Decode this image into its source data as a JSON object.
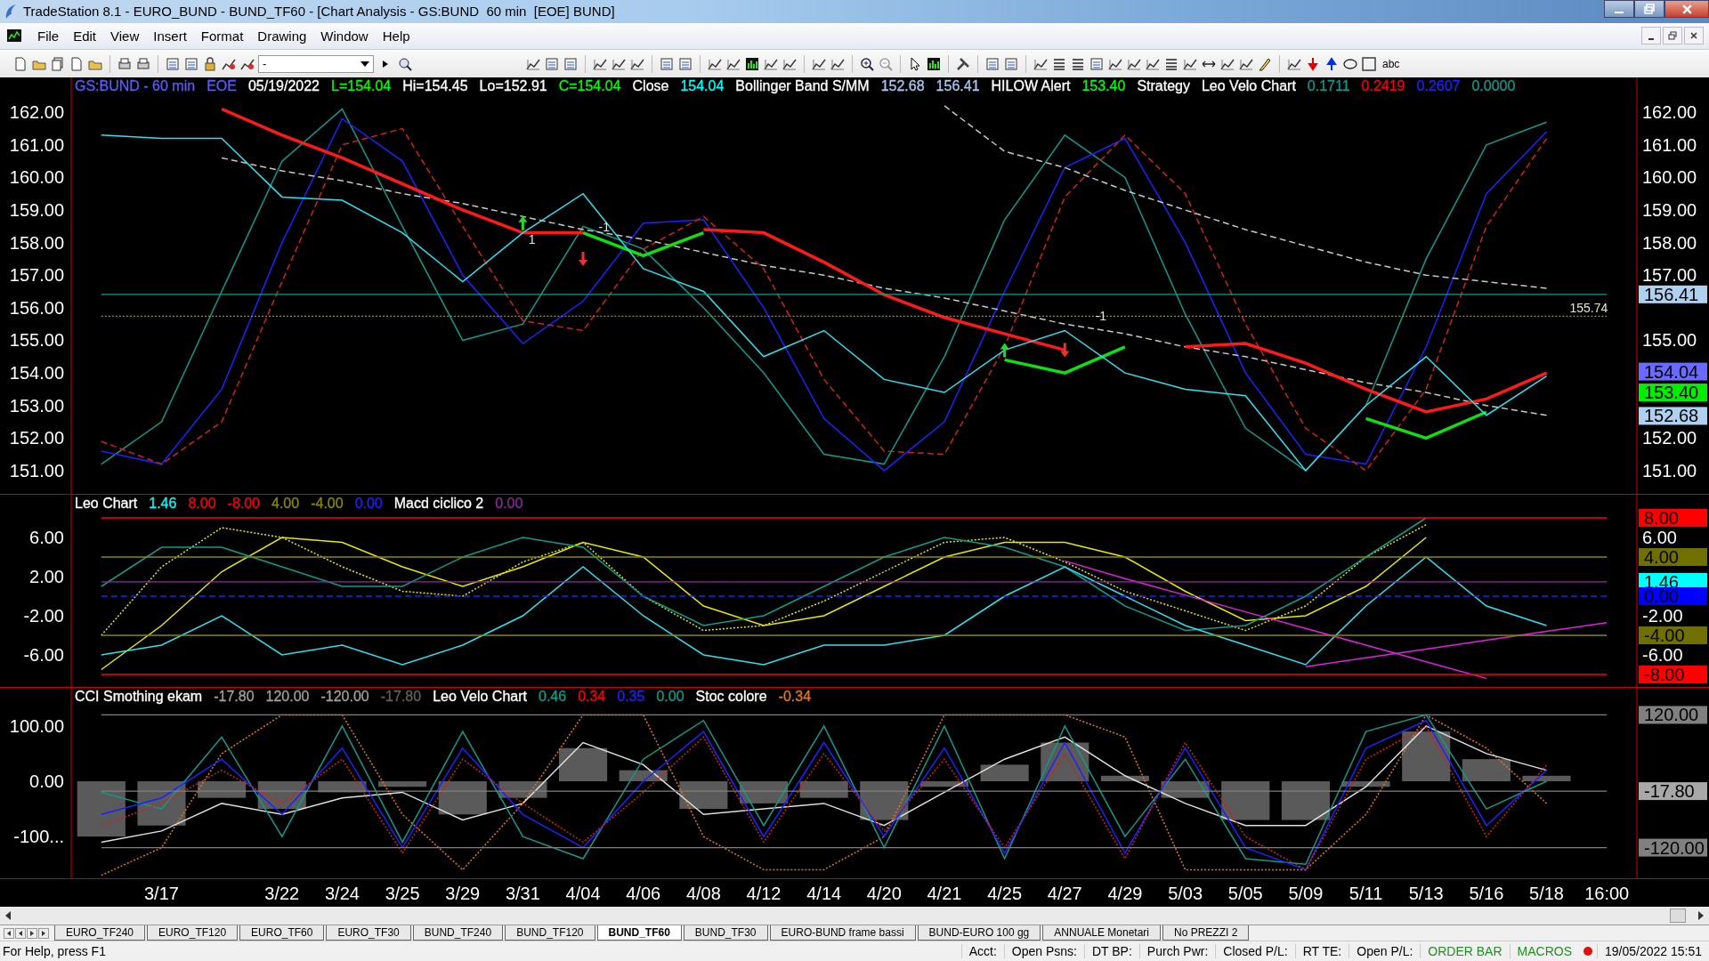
{
  "window": {
    "title": "TradeStation 8.1 - EURO_BUND - BUND_TF60 - [Chart Analysis - GS:BUND  60 min  [EOE] BUND]"
  },
  "menu": [
    "File",
    "Edit",
    "View",
    "Insert",
    "Format",
    "Drawing",
    "Window",
    "Help"
  ],
  "toolbar": {
    "combo_value": "-",
    "text_tool": "abc"
  },
  "panes": [
    {
      "header": [
        {
          "text": "GS:BUND - 60 min",
          "color": "#5a5aff"
        },
        {
          "text": "EOE",
          "color": "#5a5aff"
        },
        {
          "text": "05/19/2022",
          "color": "#ffffff"
        },
        {
          "text": "L=154.04",
          "color": "#00ff00"
        },
        {
          "text": "Hi=154.45",
          "color": "#ffffff"
        },
        {
          "text": "Lo=152.91",
          "color": "#ffffff"
        },
        {
          "text": "C=154.04",
          "color": "#00ff00"
        },
        {
          "text": "Close",
          "color": "#ffffff"
        },
        {
          "text": "154.04",
          "color": "#00ffff"
        },
        {
          "text": "Bollinger Band S/MM",
          "color": "#ffffff"
        },
        {
          "text": "152.68",
          "color": "#a8c8f0"
        },
        {
          "text": "156.41",
          "color": "#a8c8f0"
        },
        {
          "text": "HILOW Alert",
          "color": "#ffffff"
        },
        {
          "text": "153.40",
          "color": "#00ff00"
        },
        {
          "text": "Strategy",
          "color": "#ffffff"
        },
        {
          "text": "Leo Velo Chart",
          "color": "#ffffff"
        },
        {
          "text": "0.1711",
          "color": "#109a8a"
        },
        {
          "text": "0.2419",
          "color": "#ff0000"
        },
        {
          "text": "0.2607",
          "color": "#2020ff"
        },
        {
          "text": "0.0000",
          "color": "#109a8a"
        }
      ],
      "right_axis": [
        "162.00",
        "161.00",
        "160.00",
        "159.00",
        "158.00",
        "157.00",
        "155.00",
        "152.00",
        "151.00"
      ],
      "price_tags": [
        {
          "text": "156.41",
          "color": "#b0d0f0"
        },
        {
          "text": "154.04",
          "color": "#6a6aff"
        },
        {
          "text": "153.40",
          "color": "#00ee00"
        },
        {
          "text": "152.68",
          "color": "#b0d0f0"
        }
      ],
      "chart_data": {
        "type": "line",
        "ylim": [
          150.26,
          163.07
        ],
        "categories": [
          null,
          null,
          null,
          null,
          null,
          null,
          null,
          null,
          null,
          null,
          null,
          null,
          null,
          null,
          null,
          null,
          null,
          null,
          null,
          null,
          null,
          null,
          null,
          null,
          null,
          null
        ],
        "yticks": [
          {
            "value": 162,
            "label": "162.00"
          },
          {
            "value": 161,
            "label": "161.00"
          },
          {
            "value": 160,
            "label": "160.00"
          },
          {
            "value": 159,
            "label": "159.00"
          },
          {
            "value": 158,
            "label": "158.00"
          },
          {
            "value": 157,
            "label": "157.00"
          },
          {
            "value": 156,
            "label": "156.00"
          },
          {
            "value": 155,
            "label": "155.00"
          },
          {
            "value": 154,
            "label": "154.00"
          },
          {
            "value": 153,
            "label": "153.00"
          },
          {
            "value": 152,
            "label": "152.00"
          },
          {
            "value": 151,
            "label": "151.00"
          }
        ],
        "series": [
          {
            "color": "#109a8a",
            "values": [
              151.2,
              152.5,
              156.5,
              160.5,
              162.1,
              158.5,
              155.0,
              155.5,
              158.5,
              157.8,
              156.0,
              154.0,
              151.5,
              151.2,
              154.5,
              158.7,
              161.3,
              160.0,
              155.8,
              152.3,
              151.0,
              153.0,
              157.5,
              161.0,
              161.7,
              null
            ]
          },
          {
            "color": "#2020ff",
            "values": [
              151.6,
              151.2,
              153.5,
              158.0,
              161.8,
              160.5,
              157.0,
              154.9,
              156.2,
              158.6,
              158.7,
              156.0,
              152.6,
              151.0,
              152.5,
              156.5,
              160.3,
              161.2,
              158.0,
              154.0,
              151.5,
              151.2,
              154.8,
              159.5,
              161.4,
              null
            ]
          },
          {
            "color": "#d02020",
            "line_style": "dashed",
            "values": [
              151.9,
              151.2,
              152.5,
              156.8,
              161.0,
              161.5,
              158.5,
              155.6,
              155.3,
              157.8,
              158.8,
              157.2,
              153.8,
              151.6,
              151.5,
              154.8,
              159.4,
              161.3,
              159.5,
              155.5,
              152.3,
              151.0,
              153.5,
              158.5,
              161.2,
              null
            ]
          },
          {
            "color": "#c8c8c8",
            "line_style": "dashed",
            "values": [
              null,
              null,
              160.6,
              160.2,
              159.9,
              159.5,
              159.2,
              158.8,
              158.4,
              158.1,
              157.7,
              157.3,
              157.0,
              156.6,
              156.3,
              155.9,
              155.5,
              155.2,
              154.8,
              154.5,
              154.1,
              153.7,
              153.4,
              153.0,
              152.7,
              null
            ]
          },
          {
            "color": "#c8c8c8",
            "line_style": "dashed",
            "values": [
              null,
              null,
              null,
              null,
              null,
              null,
              null,
              null,
              null,
              null,
              null,
              null,
              null,
              null,
              162.2,
              160.8,
              160.3,
              159.6,
              159.0,
              158.4,
              157.9,
              157.4,
              157.0,
              156.8,
              156.6,
              null
            ]
          },
          {
            "color": "#ff1a1a",
            "values": [
              null,
              null,
              162.1,
              161.3,
              160.6,
              159.8,
              159.0,
              158.3,
              158.3,
              null,
              158.4,
              158.3,
              157.4,
              156.4,
              155.7,
              155.2,
              154.7,
              null,
              154.8,
              154.9,
              154.3,
              153.5,
              152.8,
              153.2,
              154.0,
              null
            ]
          },
          {
            "color": "#10e010",
            "values": [
              null,
              null,
              null,
              null,
              null,
              null,
              null,
              null,
              158.3,
              157.6,
              158.3,
              null,
              null,
              null,
              null,
              154.4,
              154.0,
              154.8,
              null,
              null,
              null,
              152.6,
              152.0,
              152.8,
              null,
              null
            ]
          },
          {
            "color": "#30e0f0",
            "values": [
              161.3,
              161.2,
              161.2,
              159.4,
              159.3,
              158.3,
              156.8,
              158.3,
              159.5,
              157.2,
              156.5,
              154.5,
              155.3,
              153.8,
              153.4,
              154.7,
              155.3,
              154.0,
              153.5,
              153.3,
              151.0,
              153.0,
              154.5,
              152.7,
              153.9,
              null
            ]
          },
          {
            "color": "#109a8a",
            "values": [
              156.41,
              156.41,
              156.41,
              156.41,
              156.41,
              156.41,
              156.41,
              156.41,
              156.41,
              156.41,
              156.41,
              156.41,
              156.41,
              156.41,
              156.41,
              156.41,
              156.41,
              156.41,
              156.41,
              156.41,
              156.41,
              156.41,
              156.41,
              156.41,
              156.41,
              156.41
            ]
          },
          {
            "color": "#9a9a00",
            "line_style": "dotted",
            "values": [
              155.74,
              155.74,
              155.74,
              155.74,
              155.74,
              155.74,
              155.74,
              155.74,
              155.74,
              155.74,
              155.74,
              155.74,
              155.74,
              155.74,
              155.74,
              155.74,
              155.74,
              155.74,
              155.74,
              155.74,
              155.74,
              155.74,
              155.74,
              155.74,
              155.74,
              155.74
            ]
          }
        ],
        "annotations": [
          "1",
          "-1",
          "-1",
          "155.74"
        ]
      }
    },
    {
      "header": [
        {
          "text": "Leo Chart",
          "color": "#ffffff"
        },
        {
          "text": "1.46",
          "color": "#00ffff"
        },
        {
          "text": "8.00",
          "color": "#ff0000"
        },
        {
          "text": "-8.00",
          "color": "#ff0000"
        },
        {
          "text": "4.00",
          "color": "#8a8a00"
        },
        {
          "text": "-4.00",
          "color": "#8a8a00"
        },
        {
          "text": "0.00",
          "color": "#2020ff"
        },
        {
          "text": "Macd ciclico 2",
          "color": "#ffffff"
        },
        {
          "text": "0.00",
          "color": "#8a2a9a"
        }
      ],
      "right_axis": [
        "6.00",
        "-2.00",
        "-6.00"
      ],
      "price_tags": [
        {
          "text": "8.00",
          "color": "#ff0000"
        },
        {
          "text": "4.00",
          "color": "#707000"
        },
        {
          "text": "1.46",
          "color": "#00ffff"
        },
        {
          "text": "0.00",
          "color": "#0000ff"
        },
        {
          "text": "-4.00",
          "color": "#707000"
        },
        {
          "text": "-8.00",
          "color": "#ff0000"
        }
      ],
      "chart_data": {
        "type": "line",
        "ylim": [
          -9.36,
          10.36
        ],
        "categories": [
          null,
          null,
          null,
          null,
          null,
          null,
          null,
          null,
          null,
          null,
          null,
          null,
          null,
          null,
          null,
          null,
          null,
          null,
          null,
          null,
          null,
          null,
          null,
          null,
          null,
          null
        ],
        "yticks": [
          {
            "value": 6,
            "label": "6.00"
          },
          {
            "value": 2,
            "label": "2.00"
          },
          {
            "value": -2,
            "label": "-2.00"
          },
          {
            "value": -6,
            "label": "-6.00"
          }
        ],
        "series": [
          {
            "color": "#e8e800",
            "values": [
              -7.5,
              -3,
              2.5,
              6,
              5.5,
              3,
              1,
              3,
              5.5,
              4,
              -1,
              -3,
              -2,
              1,
              4,
              5.5,
              5.5,
              4,
              0.5,
              -2.5,
              -2,
              1,
              6,
              null,
              null,
              null
            ]
          },
          {
            "color": "#e8e800",
            "line_style": "dotted",
            "values": [
              -4,
              3,
              7,
              6,
              3,
              0.5,
              0,
              3.5,
              5.5,
              0,
              -3.5,
              -3,
              -0.5,
              2.5,
              5.5,
              6,
              3.5,
              0.5,
              -1.5,
              -3.5,
              -1,
              4,
              7.3,
              null,
              null,
              null
            ]
          },
          {
            "color": "#109a8a",
            "values": [
              1,
              5,
              5,
              3,
              1,
              1,
              4,
              6,
              5,
              0,
              -3,
              -2,
              1,
              4,
              6,
              5,
              3,
              -1,
              -3.5,
              -3,
              0,
              4,
              8,
              null,
              null,
              null
            ]
          },
          {
            "color": "#30e0f0",
            "values": [
              -6,
              -5,
              -2,
              -6,
              -5,
              -7,
              -5,
              -2,
              3,
              -2,
              -6,
              -7,
              -5,
              -5,
              -4,
              0,
              3,
              0,
              -3,
              -5,
              -7,
              -1,
              4,
              -1,
              -3,
              null
            ]
          },
          {
            "color": "#e020e0",
            "values": [
              null,
              null,
              null,
              null,
              null,
              null,
              null,
              null,
              null,
              null,
              null,
              null,
              null,
              null,
              null,
              null,
              3.6,
              1.8,
              0.1,
              -1.6,
              -3.3,
              -5,
              -6.7,
              -8.4,
              null,
              null
            ]
          },
          {
            "color": "#e020e0",
            "values": [
              null,
              null,
              null,
              null,
              null,
              null,
              null,
              null,
              null,
              null,
              null,
              null,
              null,
              null,
              null,
              null,
              null,
              null,
              null,
              null,
              -7.2,
              -6.3,
              -5.4,
              -4.5,
              -3.6,
              -2.7
            ]
          },
          {
            "color": "#ff0000",
            "values": [
              8,
              8,
              8,
              8,
              8,
              8,
              8,
              8,
              8,
              8,
              8,
              8,
              8,
              8,
              8,
              8,
              8,
              8,
              8,
              8,
              8,
              8,
              8,
              8,
              8,
              8
            ]
          },
          {
            "color": "#ff0000",
            "values": [
              -8,
              -8,
              -8,
              -8,
              -8,
              -8,
              -8,
              -8,
              -8,
              -8,
              -8,
              -8,
              -8,
              -8,
              -8,
              -8,
              -8,
              -8,
              -8,
              -8,
              -8,
              -8,
              -8,
              -8,
              -8,
              -8
            ]
          },
          {
            "color": "#8a8a00",
            "values": [
              4,
              4,
              4,
              4,
              4,
              4,
              4,
              4,
              4,
              4,
              4,
              4,
              4,
              4,
              4,
              4,
              4,
              4,
              4,
              4,
              4,
              4,
              4,
              4,
              4,
              4
            ]
          },
          {
            "color": "#8a8a00",
            "values": [
              -4,
              -4,
              -4,
              -4,
              -4,
              -4,
              -4,
              -4,
              -4,
              -4,
              -4,
              -4,
              -4,
              -4,
              -4,
              -4,
              -4,
              -4,
              -4,
              -4,
              -4,
              -4,
              -4,
              -4,
              -4,
              -4
            ]
          },
          {
            "color": "#a020b0",
            "values": [
              1.46,
              1.46,
              1.46,
              1.46,
              1.46,
              1.46,
              1.46,
              1.46,
              1.46,
              1.46,
              1.46,
              1.46,
              1.46,
              1.46,
              1.46,
              1.46,
              1.46,
              1.46,
              1.46,
              1.46,
              1.46,
              1.46,
              1.46,
              1.46,
              1.46,
              1.46
            ]
          },
          {
            "color": "#2020ff",
            "line_style": "dashed",
            "values": [
              0,
              0,
              0,
              0,
              0,
              0,
              0,
              0,
              0,
              0,
              0,
              0,
              0,
              0,
              0,
              0,
              0,
              0,
              0,
              0,
              0,
              0,
              0,
              0,
              0,
              0
            ]
          }
        ]
      }
    },
    {
      "header": [
        {
          "text": "CCI Smothing ekam",
          "color": "#ffffff"
        },
        {
          "text": "-17.80",
          "color": "#a0a0a0"
        },
        {
          "text": "120.00",
          "color": "#a0a0a0"
        },
        {
          "text": "-120.00",
          "color": "#a0a0a0"
        },
        {
          "text": "-17.80",
          "color": "#606060"
        },
        {
          "text": "Leo Velo Chart",
          "color": "#ffffff"
        },
        {
          "text": "0.46",
          "color": "#109a8a"
        },
        {
          "text": "0.34",
          "color": "#ff0000"
        },
        {
          "text": "0.35",
          "color": "#2020ff"
        },
        {
          "text": "0.00",
          "color": "#109a8a"
        },
        {
          "text": "Stoc colore",
          "color": "#ffffff"
        },
        {
          "text": "-0.34",
          "color": "#e07820"
        }
      ],
      "price_tags": [
        {
          "text": "120.00",
          "color": "#808080"
        },
        {
          "text": "-17.80",
          "color": "#a8a8a8"
        },
        {
          "text": "-120.00",
          "color": "#808080"
        }
      ],
      "chart_data": {
        "type": "line",
        "ylim": [
          -177,
          169
        ],
        "categories": [
          null,
          "3/17",
          null,
          "3/22",
          "3/24",
          "3/25",
          "3/29",
          "3/31",
          "4/04",
          "4/06",
          "4/08",
          "4/12",
          "4/14",
          "4/20",
          "4/21",
          "4/25",
          "4/27",
          "4/29",
          "5/03",
          "5/05",
          "5/09",
          "5/11",
          "5/13",
          "5/16",
          "5/18",
          "16:00"
        ],
        "yticks": [
          {
            "value": 100,
            "label": "100.00"
          },
          {
            "value": 0,
            "label": "0.00"
          },
          {
            "value": -100,
            "label": "-100..."
          }
        ],
        "series": [
          {
            "type": "bar",
            "color": "#5a5a5a",
            "values": [
              -100,
              -80,
              -30,
              -50,
              -20,
              -10,
              -60,
              -30,
              60,
              20,
              -50,
              -40,
              -30,
              -70,
              -10,
              30,
              70,
              10,
              -30,
              -70,
              -70,
              -10,
              90,
              40,
              10,
              null
            ]
          },
          {
            "color": "#e07820",
            "line_style": "dotted",
            "values": [
              -170,
              -120,
              50,
              120,
              120,
              -60,
              -160,
              -40,
              120,
              120,
              -100,
              -160,
              -160,
              -100,
              120,
              120,
              120,
              80,
              -160,
              -160,
              -160,
              -60,
              120,
              60,
              -40,
              null
            ]
          },
          {
            "color": "#e0e0e0",
            "values": [
              -110,
              -90,
              -40,
              -60,
              -30,
              -20,
              -70,
              -40,
              70,
              30,
              -60,
              -50,
              -40,
              -80,
              -20,
              40,
              80,
              10,
              -40,
              -80,
              -80,
              -10,
              100,
              50,
              20,
              null
            ]
          },
          {
            "color": "#109a8a",
            "values": [
              -20,
              -50,
              80,
              -100,
              100,
              -110,
              90,
              -100,
              -140,
              40,
              110,
              -80,
              100,
              -120,
              100,
              -140,
              100,
              -100,
              40,
              -140,
              -150,
              90,
              120,
              -50,
              0,
              null
            ]
          },
          {
            "color": "#2020ff",
            "values": [
              -60,
              -30,
              40,
              -60,
              60,
              -120,
              60,
              -60,
              -120,
              0,
              90,
              -100,
              70,
              -100,
              60,
              -130,
              70,
              -130,
              60,
              -120,
              -160,
              60,
              110,
              -80,
              20,
              null
            ]
          },
          {
            "color": "#d02020",
            "line_style": "dotted",
            "values": [
              -80,
              -40,
              20,
              -40,
              40,
              -130,
              40,
              -40,
              -110,
              -20,
              80,
              -110,
              50,
              -90,
              40,
              -120,
              50,
              -140,
              70,
              -100,
              -160,
              40,
              100,
              -100,
              30,
              null
            ]
          },
          {
            "color": "#808080",
            "values": [
              120,
              120,
              120,
              120,
              120,
              120,
              120,
              120,
              120,
              120,
              120,
              120,
              120,
              120,
              120,
              120,
              120,
              120,
              120,
              120,
              120,
              120,
              120,
              120,
              120,
              120
            ]
          },
          {
            "color": "#808080",
            "values": [
              -120,
              -120,
              -120,
              -120,
              -120,
              -120,
              -120,
              -120,
              -120,
              -120,
              -120,
              -120,
              -120,
              -120,
              -120,
              -120,
              -120,
              -120,
              -120,
              -120,
              -120,
              -120,
              -120,
              -120,
              -120,
              -120
            ]
          },
          {
            "color": "#808080",
            "values": [
              -17.8,
              -17.8,
              -17.8,
              -17.8,
              -17.8,
              -17.8,
              -17.8,
              -17.8,
              -17.8,
              -17.8,
              -17.8,
              -17.8,
              -17.8,
              -17.8,
              -17.8,
              -17.8,
              -17.8,
              -17.8,
              -17.8,
              -17.8,
              -17.8,
              -17.8,
              -17.8,
              -17.8,
              -17.8,
              -17.8
            ]
          }
        ]
      }
    }
  ],
  "tabs": [
    {
      "label": "EURO_TF240",
      "selected": false
    },
    {
      "label": "EURO_TF120",
      "selected": false
    },
    {
      "label": "EURO_TF60",
      "selected": false
    },
    {
      "label": "EURO_TF30",
      "selected": false
    },
    {
      "label": "BUND_TF240",
      "selected": false
    },
    {
      "label": "BUND_TF120",
      "selected": false
    },
    {
      "label": "BUND_TF60",
      "selected": true
    },
    {
      "label": "BUND_TF30",
      "selected": false
    },
    {
      "label": "EURO-BUND frame bassi",
      "selected": false
    },
    {
      "label": "BUND-EURO 100 gg",
      "selected": false
    },
    {
      "label": "ANNUALE Monetari",
      "selected": false
    },
    {
      "label": "No PREZZI 2",
      "selected": false
    }
  ],
  "status_bar": {
    "help": "For Help, press F1",
    "fields": [
      {
        "text": "Acct:",
        "kind": "label"
      },
      {
        "text": "Open Psns:",
        "kind": "label"
      },
      {
        "text": "DT BP:",
        "kind": "label"
      },
      {
        "text": "Purch Pwr:",
        "kind": "label"
      },
      {
        "text": "Closed P/L:",
        "kind": "label"
      },
      {
        "text": "RT TE:",
        "kind": "label"
      },
      {
        "text": "Open P/L:",
        "kind": "label"
      },
      {
        "text": "ORDER BAR",
        "kind": "toggle"
      },
      {
        "text": "MACROS",
        "kind": "toggle"
      }
    ],
    "clock": "19/05/2022 15:51"
  }
}
